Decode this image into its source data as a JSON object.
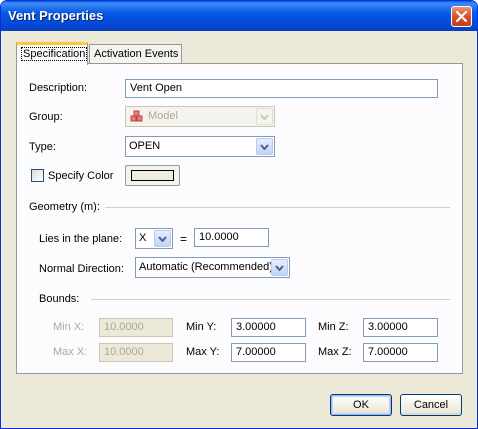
{
  "window": {
    "title": "Vent Properties"
  },
  "tabs": [
    {
      "label": "Specification",
      "active": true
    },
    {
      "label": "Activation Events",
      "active": false
    }
  ],
  "description": {
    "label": "Description:",
    "value": "Vent Open"
  },
  "group": {
    "label": "Group:",
    "value": "Model",
    "icon": "model-group-icon",
    "disabled": true
  },
  "type": {
    "label": "Type:",
    "value": "OPEN"
  },
  "specify_color": {
    "label": "Specify Color",
    "checked": false,
    "swatch_color": "#f0ede0"
  },
  "geometry": {
    "label": "Geometry (m):",
    "plane_label": "Lies in the plane:",
    "plane_axis": "X",
    "equals": "=",
    "plane_value": "10.0000",
    "normal_label": "Normal Direction:",
    "normal_value": "Automatic (Recommended)"
  },
  "bounds": {
    "label": "Bounds:",
    "min_x_label": "Min X:",
    "min_x": "10.0000",
    "max_x_label": "Max X:",
    "max_x": "10.0000",
    "min_y_label": "Min Y:",
    "min_y": "3.00000",
    "max_y_label": "Max Y:",
    "max_y": "7.00000",
    "min_z_label": "Min Z:",
    "min_z": "3.00000",
    "max_z_label": "Max Z:",
    "max_z": "7.00000"
  },
  "buttons": {
    "ok": "OK",
    "cancel": "Cancel"
  },
  "colors": {
    "title_bar": "#0758e4",
    "dialog_bg": "#ece9d8",
    "close_button": "#d8502a"
  }
}
